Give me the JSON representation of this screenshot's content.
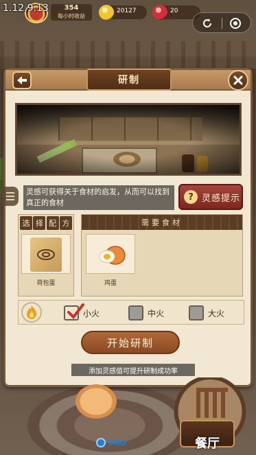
{
  "status_bar": {
    "version": "1.12.9.13",
    "income_value": "354",
    "income_label": "每小时收益",
    "coins": "20127",
    "gems": "20"
  },
  "dialog": {
    "title": "研制",
    "hint_text": "灵感可获得关于食材的启发，从而可以找到真正的食材",
    "hint_button": "灵感提示",
    "recipe_tabs": [
      "选",
      "择",
      "配",
      "方"
    ],
    "recipe_name": "荷包蛋",
    "ingredients_header": "需要食材",
    "ingredient_name": "鸡蛋",
    "heat_options": [
      {
        "label": "小火",
        "checked": true
      },
      {
        "label": "中火",
        "checked": false
      },
      {
        "label": "大火",
        "checked": false
      }
    ],
    "start_button": "开始研制",
    "tip": "添加灵感值可提升研制成功率"
  },
  "bottom": {
    "restaurant_label": "餐厅",
    "watermark": "9GO"
  },
  "colors": {
    "dialog_bg": "#f1e7d2",
    "hint_button": "#a8433a",
    "start_button": "#b0683a",
    "title_plaque": "#6d4424"
  }
}
